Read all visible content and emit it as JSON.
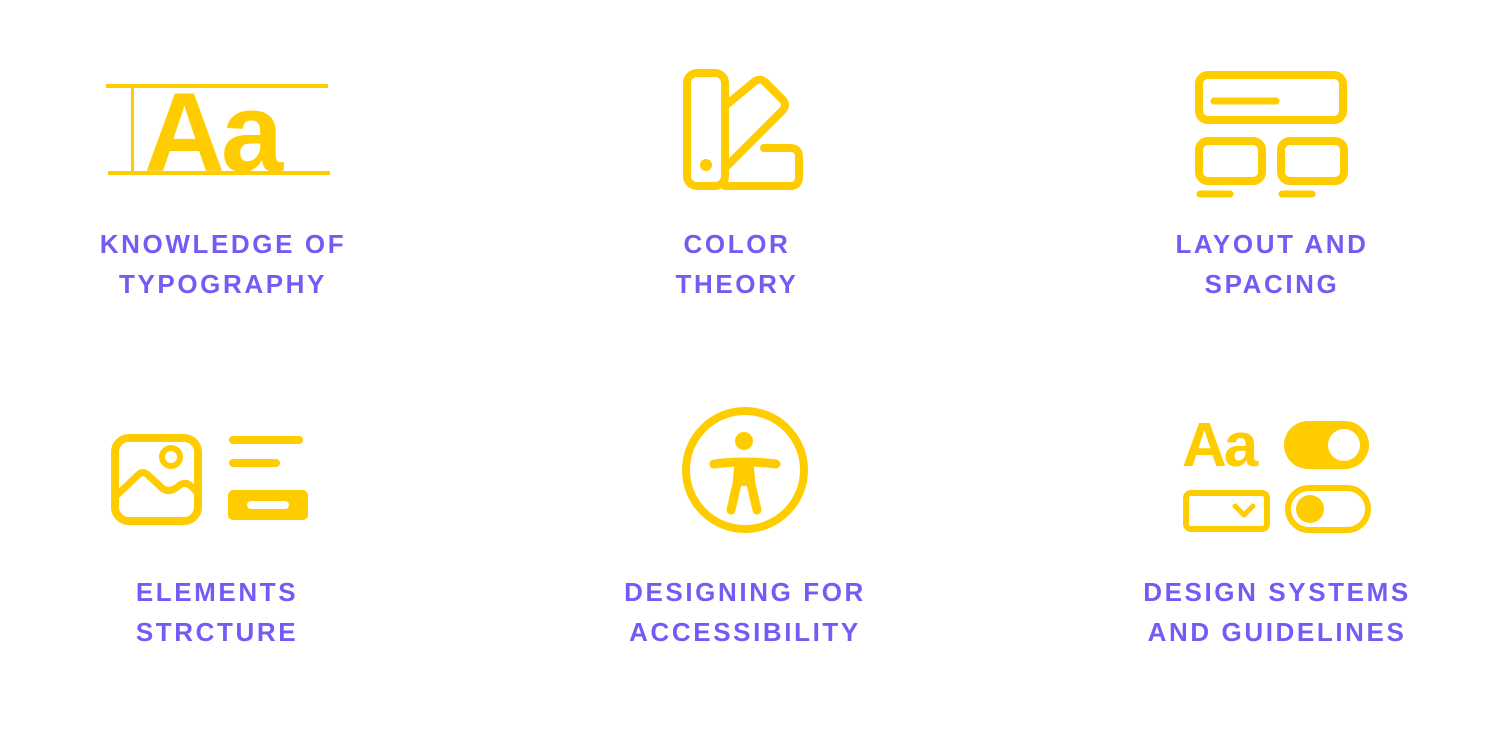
{
  "theme": {
    "accent": "#FFCC00",
    "text": "#735CF5",
    "background": "#FFFFFF"
  },
  "skills": [
    {
      "icon": "typography-icon",
      "glyph": "Aa",
      "line1": "KNOWLEDGE OF",
      "line2": "TYPOGRAPHY"
    },
    {
      "icon": "color-swatch-icon",
      "line1": "COLOR",
      "line2": "THEORY"
    },
    {
      "icon": "layout-grid-icon",
      "line1": "LAYOUT AND",
      "line2": "SPACING"
    },
    {
      "icon": "image-and-text-elements-icon",
      "line1": "ELEMENTS",
      "line2": "STRCTURE"
    },
    {
      "icon": "accessibility-icon",
      "line1": "DESIGNING FOR",
      "line2": "ACCESSIBILITY"
    },
    {
      "icon": "design-system-components-icon",
      "glyph": "Aa",
      "line1": "DESIGN SYSTEMS",
      "line2": "AND GUIDELINES"
    }
  ]
}
